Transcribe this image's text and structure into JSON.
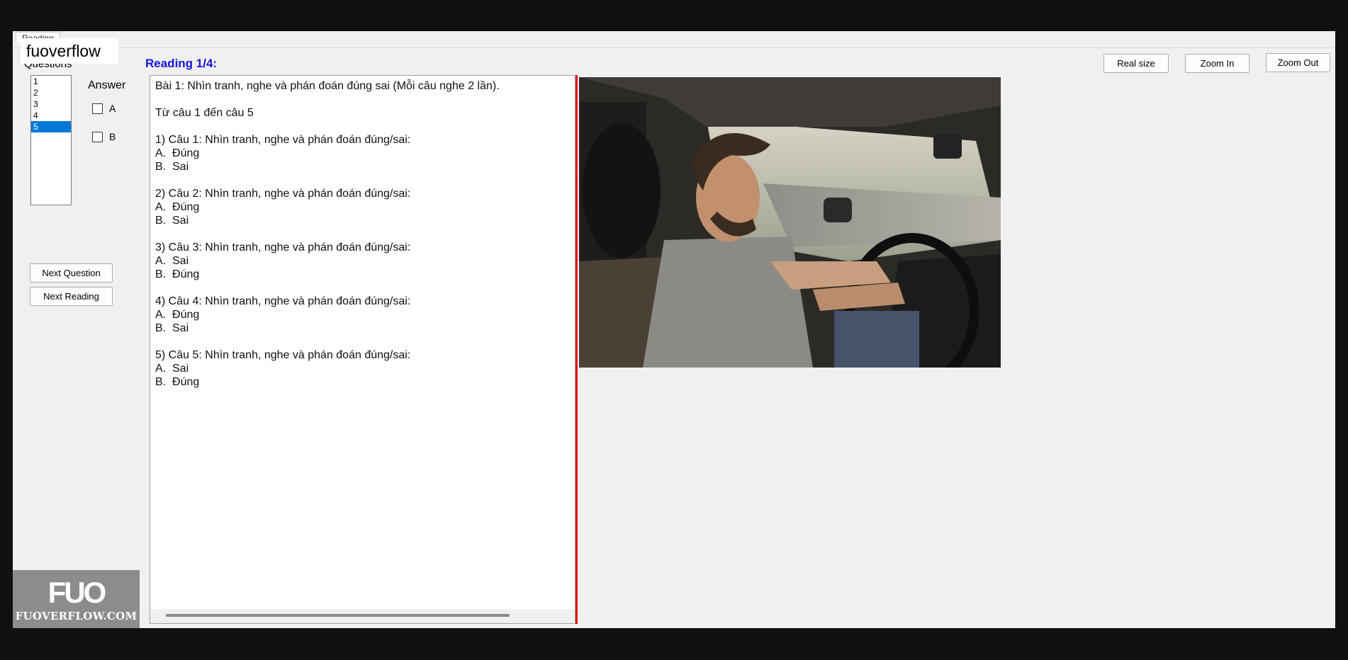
{
  "tab": {
    "label": "Reading"
  },
  "watermark_top": "fuoverflow",
  "questions": {
    "label": "Questions",
    "items": [
      "1",
      "2",
      "3",
      "4",
      "5"
    ],
    "selected": "5"
  },
  "answer": {
    "label": "Answer",
    "options": [
      "A",
      "B"
    ]
  },
  "buttons": {
    "next_question": "Next Question",
    "next_reading": "Next Reading",
    "real_size": "Real size",
    "zoom_in": "Zoom In",
    "zoom_out": "Zoom Out"
  },
  "reading": {
    "label": "Reading 1/4:",
    "lines": [
      "Bài 1: Nhìn tranh, nghe và phán đoán đúng sai (Mỗi câu nghe 2 lần).",
      "",
      "Từ câu 1 đến câu 5",
      "",
      "1) Câu 1: Nhìn tranh, nghe và phán đoán đúng/sai:",
      "A.  Đúng",
      "B.  Sai",
      "",
      "2) Câu 2: Nhìn tranh, nghe và phán đoán đúng/sai:",
      "A.  Đúng",
      "B.  Sai",
      "",
      "3) Câu 3: Nhìn tranh, nghe và phán đoán đúng/sai:",
      "A.  Sai",
      "B.  Đúng",
      "",
      "4) Câu 4: Nhìn tranh, nghe và phán đoán đúng/sai:",
      "A.  Đúng",
      "B.  Sai",
      "",
      "5) Câu 5: Nhìn tranh, nghe và phán đoán đúng/sai:",
      "A.  Sai",
      "B.  Đúng"
    ]
  },
  "logo": {
    "mark": "FUO",
    "text": "FUOVERFLOW.COM"
  },
  "colors": {
    "reading_label": "#1515e0",
    "selection": "#0078d7",
    "splitter": "#e81414"
  }
}
